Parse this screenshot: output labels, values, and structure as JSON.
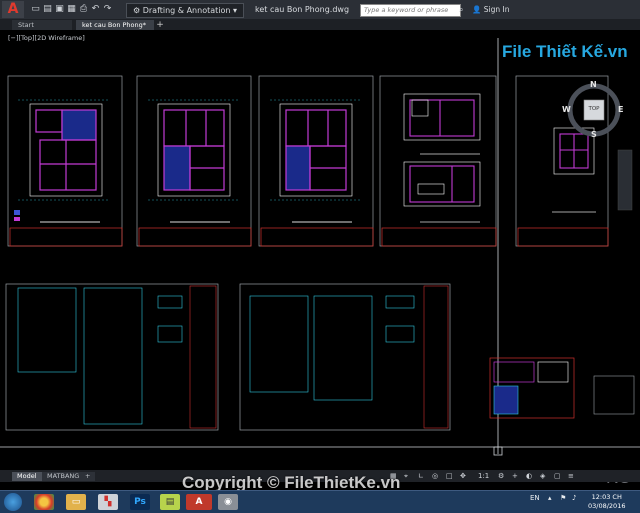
{
  "app": {
    "title": "ket cau Bon Phong.dwg",
    "workspace": "Drafting & Annotation",
    "search_placeholder": "Type a keyword or phrase",
    "sign_in": "Sign In"
  },
  "tabs": [
    {
      "label": "Start"
    },
    {
      "label": "ket cau Bon Phong*"
    }
  ],
  "viewport": {
    "label": "[−][Top][2D Wireframe]",
    "viewcube": {
      "n": "N",
      "s": "S",
      "e": "E",
      "w": "W",
      "top": "TOP"
    },
    "corner_text": "KC"
  },
  "layout_tabs": [
    {
      "label": "Model"
    },
    {
      "label": "MATBANG"
    }
  ],
  "status": {
    "scale": "1:1"
  },
  "taskbar": {
    "lang": "EN",
    "time": "12:03 CH",
    "date": "03/08/2016"
  },
  "watermark": {
    "brand": "File Thiết Kế.vn",
    "copyright": "Copyright © FileThietKe.vn"
  },
  "colors": {
    "accent": "#27a8e0",
    "frame_red": "#d0312d",
    "drawing_magenta": "#c23bd4",
    "drawing_cyan": "#31c8e0",
    "drawing_blue": "#3b54d4"
  }
}
